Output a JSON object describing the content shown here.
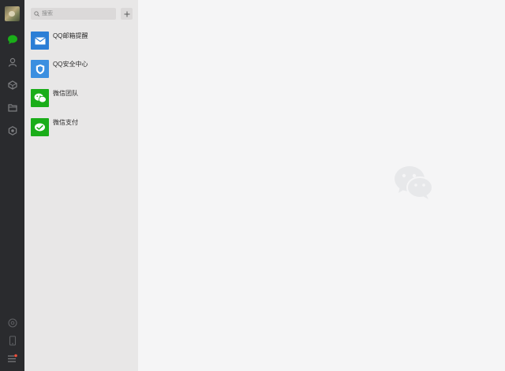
{
  "search": {
    "placeholder": "搜索"
  },
  "sidebar": {
    "icons": [
      "chat-icon",
      "contacts-icon",
      "favorites-icon",
      "files-icon",
      "mini-programs-icon",
      "moments-icon",
      "phone-icon",
      "menu-icon"
    ],
    "active_icon": "chat-icon",
    "accent_color": "#1aad19"
  },
  "chats": [
    {
      "name": "QQ邮箱提醒",
      "icon": "mail-icon",
      "color": "#2b7ed6"
    },
    {
      "name": "QQ安全中心",
      "icon": "shield-icon",
      "color": "#3b8fe0"
    },
    {
      "name": "微信团队",
      "icon": "wechat-icon",
      "color": "#1aad19"
    },
    {
      "name": "微信支付",
      "icon": "wechat-pay-icon",
      "color": "#1aad19"
    }
  ]
}
